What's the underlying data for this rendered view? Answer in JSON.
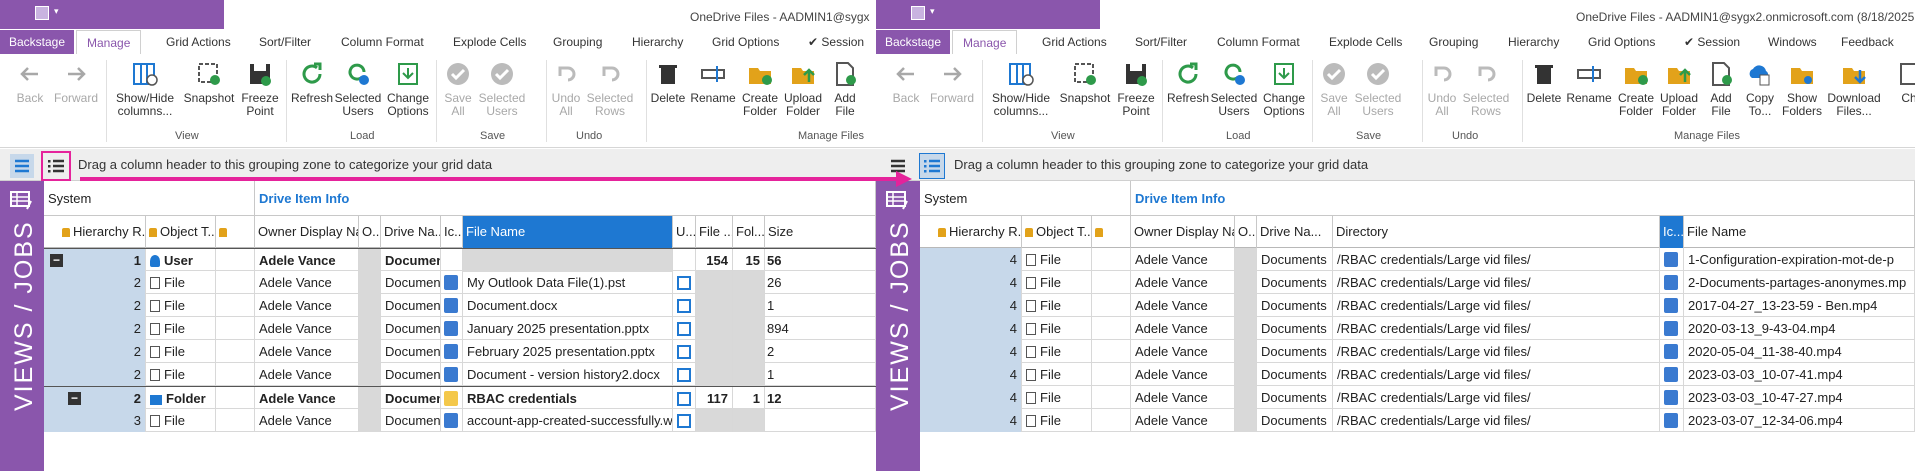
{
  "left": {
    "title": "OneDrive Files - AADMIN1@sygx",
    "tabs": [
      "Backstage",
      "Manage",
      "Grid Actions",
      "Sort/Filter",
      "Column Format",
      "Explode Cells",
      "Grouping",
      "Hierarchy",
      "Grid Options",
      "✔ Session"
    ],
    "ribbon": {
      "buttons": [
        "Back",
        "Forward",
        "Show/Hide columns...",
        "Snapshot",
        "Freeze Point",
        "Refresh",
        "Selected Users",
        "Change Options",
        "Save All",
        "Selected Users",
        "Undo All",
        "Selected Rows",
        "Delete",
        "Rename",
        "Create Folder",
        "Upload Folder",
        "Add File"
      ],
      "groups": [
        "View",
        "Load",
        "Save",
        "Undo",
        "Manage Files"
      ]
    },
    "groupzone_text": "Drag a column header to this grouping zone to categorize your grid data",
    "bands": [
      "System",
      "Drive Item Info"
    ],
    "headers": [
      "Hierarchy R...",
      "Object T...",
      "Owner Display Name",
      "O...",
      "Drive Na...",
      "Ic...",
      "File Name",
      "U...",
      "File ...",
      "Fol...",
      "Size"
    ],
    "rows": [
      {
        "h": "1",
        "obj": "User",
        "owner": "Adele Vance",
        "drive": "Documents",
        "file": "",
        "f1": "154",
        "f2": "15",
        "size": "56",
        "type": "user"
      },
      {
        "h": "2",
        "obj": "File",
        "owner": "Adele Vance",
        "drive": "Documents",
        "file": "My Outlook Data File(1).pst",
        "f1": "",
        "f2": "",
        "size": "26",
        "type": "file"
      },
      {
        "h": "2",
        "obj": "File",
        "owner": "Adele Vance",
        "drive": "Documents",
        "file": "Document.docx",
        "f1": "",
        "f2": "",
        "size": "1",
        "type": "file"
      },
      {
        "h": "2",
        "obj": "File",
        "owner": "Adele Vance",
        "drive": "Documents",
        "file": "January 2025 presentation.pptx",
        "f1": "",
        "f2": "",
        "size": "894",
        "type": "file"
      },
      {
        "h": "2",
        "obj": "File",
        "owner": "Adele Vance",
        "drive": "Documents",
        "file": "February 2025 presentation.pptx",
        "f1": "",
        "f2": "",
        "size": "2",
        "type": "file"
      },
      {
        "h": "2",
        "obj": "File",
        "owner": "Adele Vance",
        "drive": "Documents",
        "file": "Document - version history2.docx",
        "f1": "",
        "f2": "",
        "size": "1",
        "type": "file"
      },
      {
        "h": "2",
        "obj": "Folder",
        "owner": "Adele Vance",
        "drive": "Documents",
        "file": "RBAC credentials",
        "f1": "117",
        "f2": "1",
        "size": "12",
        "type": "folder"
      },
      {
        "h": "3",
        "obj": "File",
        "owner": "Adele Vance",
        "drive": "Documents",
        "file": "account-app-created-successfully.webp",
        "f1": "",
        "f2": "",
        "size": "",
        "type": "file"
      }
    ]
  },
  "right": {
    "title": "OneDrive Files - AADMIN1@sygx2.onmicrosoft.com (8/18/2025",
    "tabs": [
      "Backstage",
      "Manage",
      "Grid Actions",
      "Sort/Filter",
      "Column Format",
      "Explode Cells",
      "Grouping",
      "Hierarchy",
      "Grid Options",
      "✔ Session",
      "Windows",
      "Feedback"
    ],
    "ribbon": {
      "buttons": [
        "Back",
        "Forward",
        "Show/Hide columns...",
        "Snapshot",
        "Freeze Point",
        "Refresh",
        "Selected Users",
        "Change Options",
        "Save All",
        "Selected Users",
        "Undo All",
        "Selected Rows",
        "Delete",
        "Rename",
        "Create Folder",
        "Upload Folder",
        "Add File",
        "Copy To...",
        "Show Folders",
        "Download Files...",
        "Ch"
      ],
      "groups": [
        "View",
        "Load",
        "Save",
        "Undo",
        "Manage Files"
      ]
    },
    "groupzone_text": "Drag a column header to this grouping zone to categorize your grid data",
    "bands": [
      "System",
      "Drive Item Info"
    ],
    "headers": [
      "Hierarchy R...",
      "Object T...",
      "Owner Display Name",
      "O...",
      "Drive Na...",
      "Directory",
      "Ic...",
      "File Name"
    ],
    "rows": [
      {
        "h": "4",
        "obj": "File",
        "owner": "Adele Vance",
        "drive": "Documents",
        "dir": "/RBAC credentials/Large vid files/",
        "file": "1-Configuration-expiration-mot-de-p"
      },
      {
        "h": "4",
        "obj": "File",
        "owner": "Adele Vance",
        "drive": "Documents",
        "dir": "/RBAC credentials/Large vid files/",
        "file": "2-Documents-partages-anonymes.mp"
      },
      {
        "h": "4",
        "obj": "File",
        "owner": "Adele Vance",
        "drive": "Documents",
        "dir": "/RBAC credentials/Large vid files/",
        "file": "2017-04-27_13-23-59 - Ben.mp4"
      },
      {
        "h": "4",
        "obj": "File",
        "owner": "Adele Vance",
        "drive": "Documents",
        "dir": "/RBAC credentials/Large vid files/",
        "file": "2020-03-13_9-43-04.mp4"
      },
      {
        "h": "4",
        "obj": "File",
        "owner": "Adele Vance",
        "drive": "Documents",
        "dir": "/RBAC credentials/Large vid files/",
        "file": "2020-05-04_11-38-40.mp4"
      },
      {
        "h": "4",
        "obj": "File",
        "owner": "Adele Vance",
        "drive": "Documents",
        "dir": "/RBAC credentials/Large vid files/",
        "file": "2023-03-03_10-07-41.mp4"
      },
      {
        "h": "4",
        "obj": "File",
        "owner": "Adele Vance",
        "drive": "Documents",
        "dir": "/RBAC credentials/Large vid files/",
        "file": "2023-03-03_10-47-27.mp4"
      },
      {
        "h": "4",
        "obj": "File",
        "owner": "Adele Vance",
        "drive": "Documents",
        "dir": "/RBAC credentials/Large vid files/",
        "file": "2023-03-07_12-34-06.mp4"
      }
    ]
  },
  "side_panel_label": "VIEWS / JOBS",
  "colors": {
    "accent": "#8a56ac",
    "highlight": "#e5239b",
    "selection": "#1e78d2"
  }
}
